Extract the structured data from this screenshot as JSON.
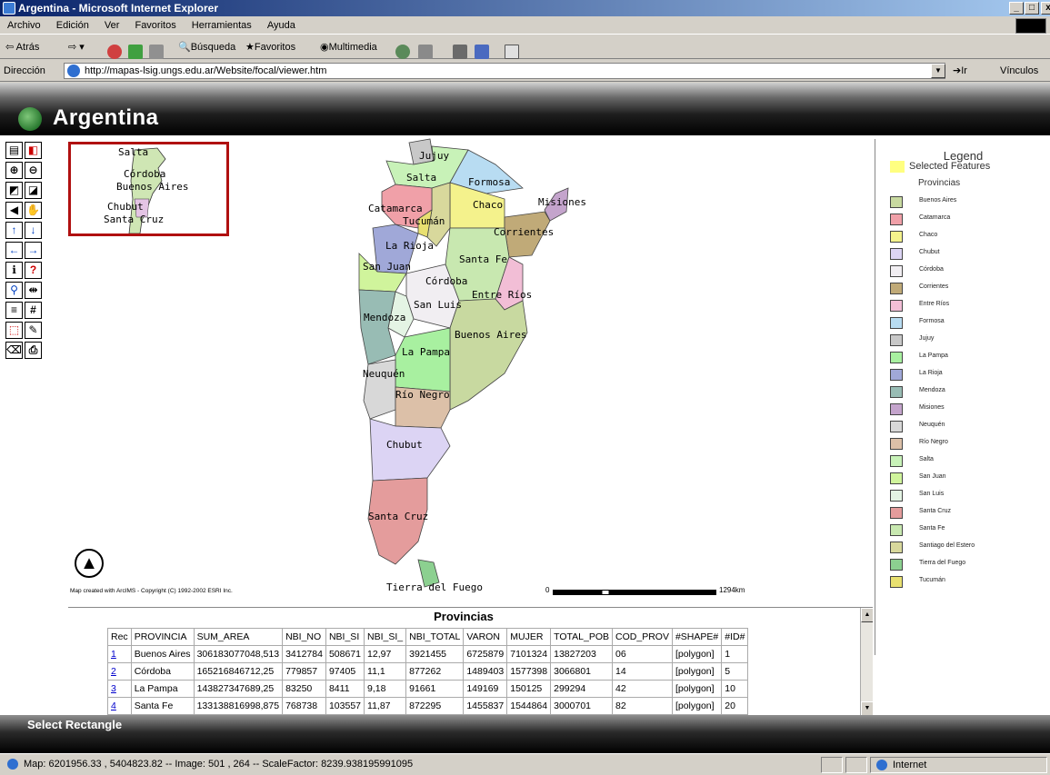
{
  "window": {
    "title": "Argentina - Microsoft Internet Explorer",
    "min": "_",
    "max": "□",
    "close": "x"
  },
  "menu": [
    "Archivo",
    "Edición",
    "Ver",
    "Favoritos",
    "Herramientas",
    "Ayuda"
  ],
  "toolbar": {
    "back": "Atrás",
    "search": "Búsqueda",
    "favorites": "Favoritos",
    "media": "Multimedia"
  },
  "address": {
    "label": "Dirección",
    "url": "http://mapas-lsig.ungs.edu.ar/Website/focal/viewer.htm",
    "go": "Ir",
    "links": "Vínculos"
  },
  "app": {
    "title": "Argentina"
  },
  "overview": {
    "labels": [
      "Salta",
      "Córdoba",
      "Buenos Aires",
      "Chubut",
      "Santa Cruz"
    ]
  },
  "map": {
    "labels": {
      "jujuy": "Jujuy",
      "salta": "Salta",
      "formosa": "Formosa",
      "catamarca": "Catamarca",
      "chaco": "Chaco",
      "misiones": "Misiones",
      "tucuman": "Tucumán",
      "corrientes": "Corrientes",
      "larioja": "La Rioja",
      "santafe": "Santa Fe",
      "sanjuan": "San Juan",
      "cordoba": "Córdoba",
      "entrerios": "Entre Ríos",
      "sanluis": "San Luis",
      "mendoza": "Mendoza",
      "buenosaires": "Buenos Aires",
      "lapampa": "La Pampa",
      "neuquen": "Neuquén",
      "rionegro": "Río Negro",
      "chubut": "Chubut",
      "santacruz": "Santa Cruz",
      "tierradelfuego": "Tierra del Fuego"
    },
    "credit": "Map created with ArcIMS - Copyright (C) 1992-2002 ESRI Inc.",
    "scale_start": "0",
    "scale_end": "1294km"
  },
  "legend": {
    "title": "Legend",
    "selected": "Selected Features",
    "layer": "Provincias",
    "items": [
      {
        "label": "Buenos Aires",
        "color": "#c8d9a0"
      },
      {
        "label": "Catamarca",
        "color": "#f0a0a8"
      },
      {
        "label": "Chaco",
        "color": "#f4f28c"
      },
      {
        "label": "Chubut",
        "color": "#dcd4f4"
      },
      {
        "label": "Córdoba",
        "color": "#f1eef2"
      },
      {
        "label": "Corrientes",
        "color": "#c0aa78"
      },
      {
        "label": "Entre Ríos",
        "color": "#f2bed6"
      },
      {
        "label": "Formosa",
        "color": "#b8dcf2"
      },
      {
        "label": "Jujuy",
        "color": "#c8c8c8"
      },
      {
        "label": "La Pampa",
        "color": "#a8f0a0"
      },
      {
        "label": "La Rioja",
        "color": "#a0a8d8"
      },
      {
        "label": "Mendoza",
        "color": "#98bcb4"
      },
      {
        "label": "Misiones",
        "color": "#c4a4cc"
      },
      {
        "label": "Neuquén",
        "color": "#d8d8d8"
      },
      {
        "label": "Río Negro",
        "color": "#dcc0a8"
      },
      {
        "label": "Salta",
        "color": "#c8f2b8"
      },
      {
        "label": "San Juan",
        "color": "#d0f49c"
      },
      {
        "label": "San Luis",
        "color": "#e4f4e4"
      },
      {
        "label": "Santa Cruz",
        "color": "#e49c9c"
      },
      {
        "label": "Santa Fe",
        "color": "#c8e8b0"
      },
      {
        "label": "Santiago del Estero",
        "color": "#d8d89c"
      },
      {
        "label": "Tierra del Fuego",
        "color": "#8cd090"
      },
      {
        "label": "Tucumán",
        "color": "#e8e070"
      }
    ]
  },
  "table": {
    "title": "Provincias",
    "headers": [
      "Rec",
      "PROVINCIA",
      "SUM_AREA",
      "NBI_NO",
      "NBI_SI",
      "NBI_SI_",
      "NBI_TOTAL",
      "VARON",
      "MUJER",
      "TOTAL_POB",
      "COD_PROV",
      "#SHAPE#",
      "#ID#"
    ],
    "rows": [
      [
        "1",
        "Buenos Aires",
        "306183077048,513",
        "3412784",
        "508671",
        "12,97",
        "3921455",
        "6725879",
        "7101324",
        "13827203",
        "06",
        "[polygon]",
        "1"
      ],
      [
        "2",
        "Córdoba",
        "165216846712,25",
        "779857",
        "97405",
        "11,1",
        "877262",
        "1489403",
        "1577398",
        "3066801",
        "14",
        "[polygon]",
        "5"
      ],
      [
        "3",
        "La Pampa",
        "143827347689,25",
        "83250",
        "8411",
        "9,18",
        "91661",
        "149169",
        "150125",
        "299294",
        "42",
        "[polygon]",
        "10"
      ],
      [
        "4",
        "Santa Fe",
        "133138816998,875",
        "768738",
        "103557",
        "11,87",
        "872295",
        "1455837",
        "1544864",
        "3000701",
        "82",
        "[polygon]",
        "20"
      ]
    ]
  },
  "tool_label": "Select Rectangle",
  "status": {
    "text": "Map: 6201956.33 , 5404823.82 -- Image: 501 , 264 -- ScaleFactor: 8239.938195991095",
    "zone": "Internet"
  }
}
